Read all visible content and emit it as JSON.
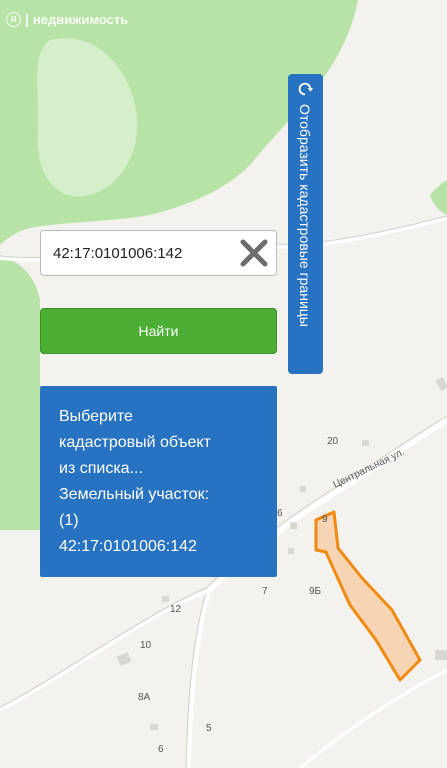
{
  "header": {
    "logo_letter": "Я",
    "title": "недвижимость"
  },
  "search": {
    "value": "42:17:0101006:142",
    "placeholder": ""
  },
  "find_button": {
    "label": "Найти"
  },
  "cadastral_toggle": {
    "label": "Отобразить кадастровые границы"
  },
  "info_panel": {
    "lines": [
      "Выберите",
      "кадастровый объект",
      "из списка...",
      "Земельный участок:",
      "(1)",
      "42:17:0101006:142"
    ]
  },
  "map": {
    "street_name": "Центральная ул.",
    "house_numbers": [
      "20",
      "6",
      "9",
      "7",
      "9Б",
      "12",
      "10",
      "8А",
      "5",
      "6"
    ],
    "colors": {
      "background": "#f3f2ee",
      "forest": "#b7e3a6",
      "forest_light": "#d6efcb",
      "parcel_fill": "#f7cfa8",
      "parcel_stroke": "#f08a10",
      "panel_blue": "#2872c2",
      "button_green": "#4cae35"
    }
  }
}
